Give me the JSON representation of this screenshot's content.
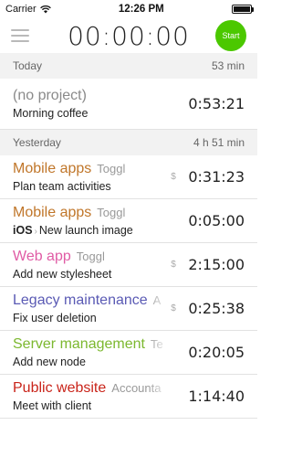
{
  "status": {
    "carrier": "Carrier",
    "time": "12:26 PM",
    "battery_level": 1.0
  },
  "header": {
    "timer": "00:00:00",
    "start_label": "Start",
    "start_color": "#4bc800"
  },
  "sections": [
    {
      "title": "Today",
      "total": "53 min",
      "entries": [
        {
          "project": "(no project)",
          "client": "",
          "description": "Morning coffee",
          "billable": "",
          "duration": "0:53:21",
          "color": "#8a8a8a"
        }
      ]
    },
    {
      "title": "Yesterday",
      "total": "4 h 51 min",
      "entries": [
        {
          "project": "Mobile apps",
          "client": "Toggl",
          "description": "Plan team activities",
          "billable": "$",
          "duration": "0:31:23",
          "color": "#c0762a"
        },
        {
          "project": "Mobile apps",
          "client": "Toggl",
          "description_prefix": "iOS",
          "description": "New launch image",
          "billable": "",
          "duration": "0:05:00",
          "color": "#c0762a"
        },
        {
          "project": "Web app",
          "client": "Toggl",
          "description": "Add new stylesheet",
          "billable": "$",
          "duration": "2:15:00",
          "color": "#e05ca5"
        },
        {
          "project": "Legacy maintenance",
          "client": "A",
          "description": "Fix user deletion",
          "billable": "$",
          "duration": "0:25:38",
          "color": "#5a5ab4"
        },
        {
          "project": "Server management",
          "client": "Te",
          "description": "Add new node",
          "billable": "",
          "duration": "0:20:05",
          "color": "#7cb82f"
        },
        {
          "project": "Public website",
          "client": "Accounta",
          "description": "Meet with client",
          "billable": "",
          "duration": "1:14:40",
          "color": "#c9241a"
        }
      ]
    }
  ]
}
